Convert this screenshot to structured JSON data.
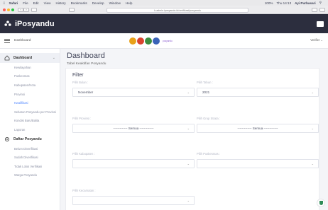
{
  "menubar": {
    "app": "Safari",
    "items": [
      "File",
      "Edit",
      "View",
      "History",
      "Bookmarks",
      "Develop",
      "Window",
      "Help"
    ],
    "battery": "100%",
    "clock": "Thu 14:13",
    "user": "Ayi Purbasari"
  },
  "toolbar": {
    "url": "k-admin.iposyandu.id/verifikasi/posyandu",
    "back": "‹",
    "forward": "›"
  },
  "app": {
    "title": "iPosyandu"
  },
  "subheader": {
    "breadcrumb": "Dashboard",
    "banner_text": "posyandu",
    "verify_label": "Verifier"
  },
  "sidebar": {
    "dashboard_label": "Dashboard",
    "dashboard_items": [
      "Kewilayahan",
      "Puskesmas",
      "Kabupaten/Kota",
      "Provinsi",
      "Kwalifikasi",
      "Sebaran Posyandu per Provinsi",
      "Kondisi Baru/Balita",
      "Laporan"
    ],
    "active_index": 4,
    "daftar_label": "Daftar Posyandu",
    "daftar_items": [
      "Belum Diverifikasi",
      "Sudah Diverifikasi",
      "Tidak Lolos Verifikasi",
      "Warga Posyandu"
    ]
  },
  "main": {
    "title": "Dashboard",
    "subtitle": "Tabel Keaktifan Posyandu",
    "filter_title": "Filter",
    "fields": {
      "bulan": {
        "label": "Pilih Bulan :",
        "value": "November"
      },
      "tahun": {
        "label": "Pilih Tahun :",
        "value": "2021"
      },
      "provinsi": {
        "label": "Pilih Provinsi :",
        "value": "------------- Semua -------------"
      },
      "strata": {
        "label": "Pilih Grup Strata :",
        "value": "------------- Semua -------------"
      },
      "kabupaten": {
        "label": "Pilih Kabupaten :",
        "value": ""
      },
      "puskesmas": {
        "label": "Pilih Puskesmas :",
        "value": ""
      },
      "kecamatan": {
        "label": "Pilih Kecamatan :",
        "value": ""
      }
    }
  },
  "colors": {
    "appbar": "#2c2e3e",
    "accent": "#4f86ff",
    "shield": "#2e8b57"
  }
}
